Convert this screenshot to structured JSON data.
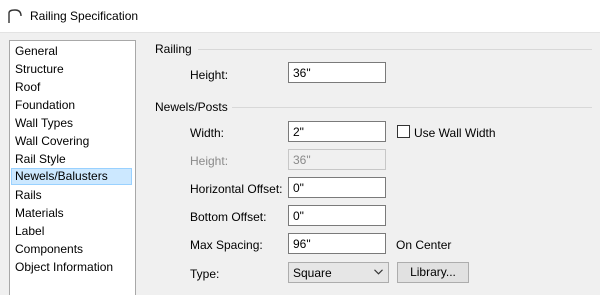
{
  "window": {
    "title": "Railing Specification",
    "icon": "railing-arc-icon"
  },
  "nav": {
    "items": [
      "General",
      "Structure",
      "Roof",
      "Foundation",
      "Wall Types",
      "Wall Covering",
      "Rail Style",
      "Newels/Balusters",
      "Rails",
      "Materials",
      "Label",
      "Components",
      "Object Information"
    ],
    "selected": "Newels/Balusters"
  },
  "railing": {
    "section_label": "Railing",
    "height_label": "Height:",
    "height_value": "36\""
  },
  "newels": {
    "section_label": "Newels/Posts",
    "width_label": "Width:",
    "width_value": "2\"",
    "use_wall_width_label": "Use Wall Width",
    "use_wall_width_checked": false,
    "height_label": "Height:",
    "height_value": "36\"",
    "horizontal_offset_label": "Horizontal Offset:",
    "horizontal_offset_value": "0\"",
    "bottom_offset_label": "Bottom Offset:",
    "bottom_offset_value": "0\"",
    "max_spacing_label": "Max Spacing:",
    "max_spacing_value": "96\"",
    "on_center_label": "On Center",
    "type_label": "Type:",
    "type_value": "Square",
    "library_label": "Library..."
  }
}
